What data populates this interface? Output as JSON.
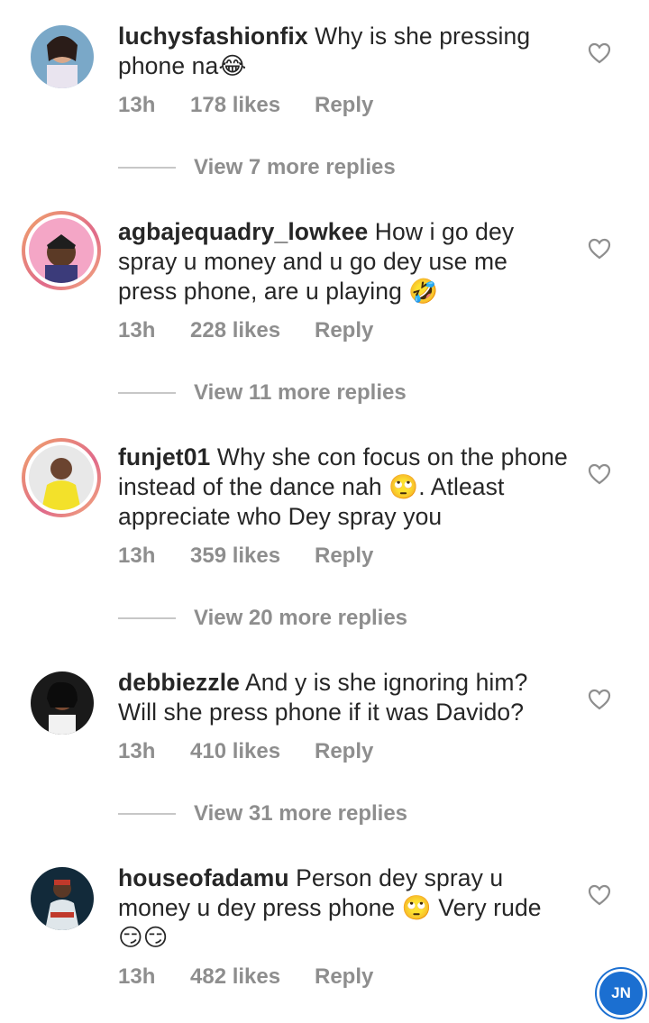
{
  "comments": [
    {
      "username": "luchysfashionfix",
      "text": "Why is she pressing phone na",
      "emojis": [
        "😂"
      ],
      "time": "13h",
      "likes": "178 likes",
      "reply": "Reply",
      "view_replies": "View 7 more replies"
    },
    {
      "username": "agbajequadry_lowkee",
      "text": "How i go dey spray u money and u go dey use me press phone, are u playing",
      "emojis": [
        "🤣"
      ],
      "time": "13h",
      "likes": "228 likes",
      "reply": "Reply",
      "view_replies": "View 11 more replies"
    },
    {
      "username": "funjet01",
      "text_a": "Why she con focus on the phone instead of the dance nah",
      "emoji": "🙄",
      "text_b": ". Atleast appreciate who Dey spray you",
      "time": "13h",
      "likes": "359 likes",
      "reply": "Reply",
      "view_replies": "View 20 more replies"
    },
    {
      "username": "debbiezzle",
      "text": "And y is she ignoring him? Will she press phone if it was Davido?",
      "time": "13h",
      "likes": "410 likes",
      "reply": "Reply",
      "view_replies": "View 31 more replies"
    },
    {
      "username": "houseofadamu",
      "text_a": "Person dey spray u money u dey press phone",
      "emoji": "🙄",
      "text_b": "Very rude",
      "emojis_end": [
        "😏",
        "😏"
      ],
      "time": "13h",
      "likes": "482 likes",
      "reply": "Reply"
    }
  ],
  "watermark": "JN",
  "colors": {
    "text": "#262626",
    "meta": "#8e8e8e",
    "line": "#c7c7c7"
  }
}
